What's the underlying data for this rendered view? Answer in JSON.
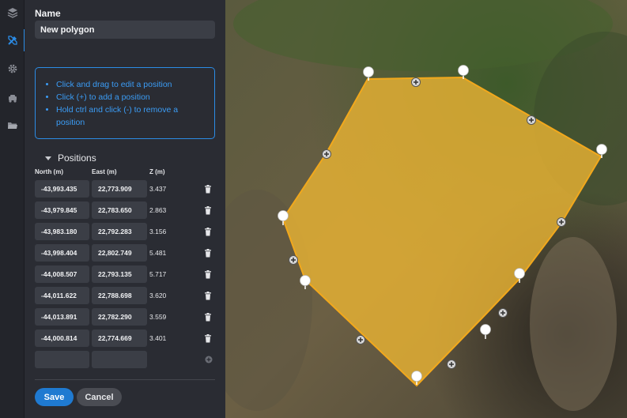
{
  "rail": {
    "items": [
      {
        "icon": "layers-icon"
      },
      {
        "icon": "draw-tools-icon",
        "active": true
      },
      {
        "icon": "gear-icon"
      },
      {
        "icon": "vehicle-icon"
      },
      {
        "icon": "folder-icon"
      }
    ]
  },
  "panel": {
    "name_label": "Name",
    "name_value": "New polygon",
    "help": [
      "Click and drag to edit a position",
      "Click (+) to add a position",
      "Hold ctrl and click (-) to remove a position"
    ],
    "positions_title": "Positions",
    "columns": {
      "north": "North (m)",
      "east": "East (m)",
      "z": "Z (m)"
    },
    "rows": [
      {
        "north": "-43,993.435",
        "east": "22,773.909",
        "z": "3.437"
      },
      {
        "north": "-43,979.845",
        "east": "22,783.650",
        "z": "2.863"
      },
      {
        "north": "-43,983.180",
        "east": "22,792.283",
        "z": "3.156"
      },
      {
        "north": "-43,998.404",
        "east": "22,802.749",
        "z": "5.481"
      },
      {
        "north": "-44,008.507",
        "east": "22,793.135",
        "z": "5.717"
      },
      {
        "north": "-44,011.622",
        "east": "22,788.698",
        "z": "3.620"
      },
      {
        "north": "-44,013.891",
        "east": "22,782.290",
        "z": "3.559"
      },
      {
        "north": "-44,000.814",
        "east": "22,774.669",
        "z": "3.401"
      }
    ],
    "new_row": {
      "north": "",
      "east": ""
    },
    "save_label": "Save",
    "cancel_label": "Cancel"
  },
  "colors": {
    "accent": "#2b8ce6",
    "polygon_fill": "#e8b233",
    "polygon_stroke": "#f2a81c",
    "panel_bg": "#2a2c33"
  }
}
